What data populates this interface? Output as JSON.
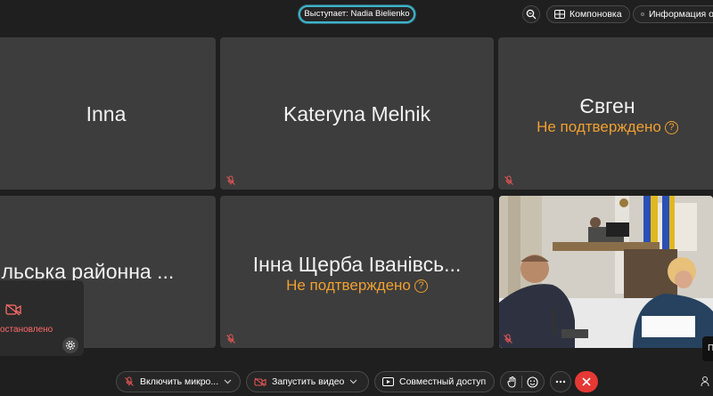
{
  "header": {
    "speaker_label": "Выступает: Nadia Bielienko",
    "layout_button": "Компоновка",
    "info_button": "Информация о"
  },
  "tiles": [
    {
      "name": "Inna"
    },
    {
      "name": "Kateryna Melnik"
    },
    {
      "name": "Євген",
      "status": "Не подтверждено"
    },
    {
      "name": "айльська районна ..."
    },
    {
      "name": "Інна Щерба Іванівсь...",
      "status": "Не подтверждено"
    }
  ],
  "self_view": {
    "status": "остановлено"
  },
  "toolbar": {
    "mic_label": "Включить микро...",
    "video_label": "Запустить видео",
    "share_label": "Совместный доступ"
  },
  "corner_text": "П",
  "colors": {
    "accent": "#3fb3c9",
    "warning": "#f0a030",
    "danger": "#e53935",
    "tile_bg": "#3d3d3d"
  }
}
